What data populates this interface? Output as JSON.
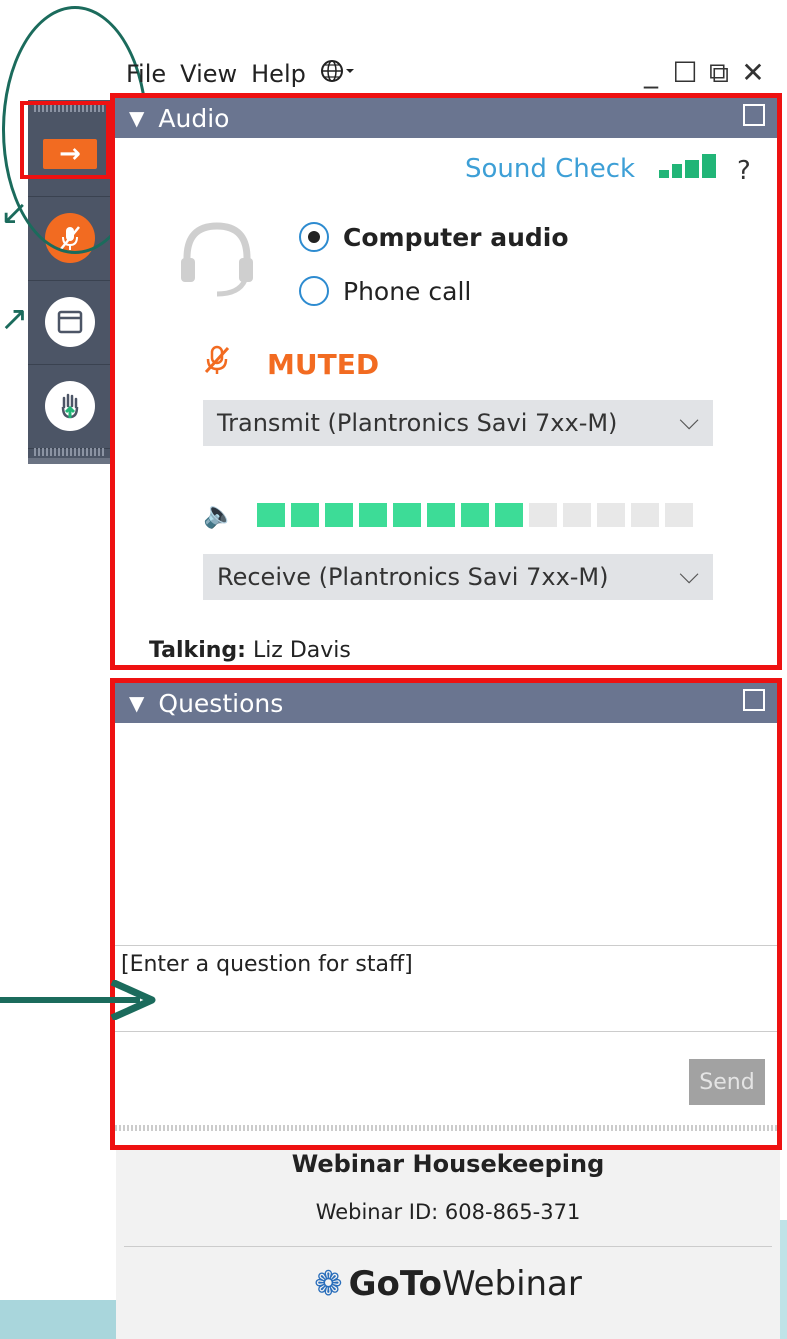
{
  "menu": {
    "items": [
      "File",
      "View",
      "Help"
    ],
    "globe_icon": "globe-icon",
    "window_controls": [
      "minimize",
      "maximize",
      "restore",
      "close"
    ]
  },
  "sidebar": {
    "buttons": [
      {
        "name": "collapse-arrow",
        "icon": "arrow-right-icon"
      },
      {
        "name": "mute-toggle",
        "icon": "mic-muted-icon"
      },
      {
        "name": "screen-view",
        "icon": "window-icon"
      },
      {
        "name": "raise-hand",
        "icon": "hand-icon"
      }
    ]
  },
  "audio": {
    "header": "Audio",
    "sound_check": "Sound Check",
    "help": "?",
    "options": [
      {
        "label": "Computer audio",
        "checked": true
      },
      {
        "label": "Phone call",
        "checked": false
      }
    ],
    "muted_label": "MUTED",
    "transmit": "Transmit (Plantronics Savi 7xx-M)",
    "receive": "Receive (Plantronics Savi 7xx-M)",
    "level_active": 8,
    "level_total": 13,
    "talking_label": "Talking:",
    "talking_name": "Liz Davis"
  },
  "questions": {
    "header": "Questions",
    "input_placeholder": "[Enter a question for staff]",
    "send": "Send"
  },
  "footer": {
    "title": "Webinar Housekeeping",
    "webinar_id": "Webinar ID: 608-865-371",
    "logo_bold": "GoTo",
    "logo_regular": "Webinar"
  },
  "colors": {
    "accent_orange": "#f26b21",
    "highlight_red": "#ee1111",
    "annotation_green": "#1b6b5c",
    "header_slate": "#6a7590",
    "link_blue": "#3d9fd6"
  }
}
